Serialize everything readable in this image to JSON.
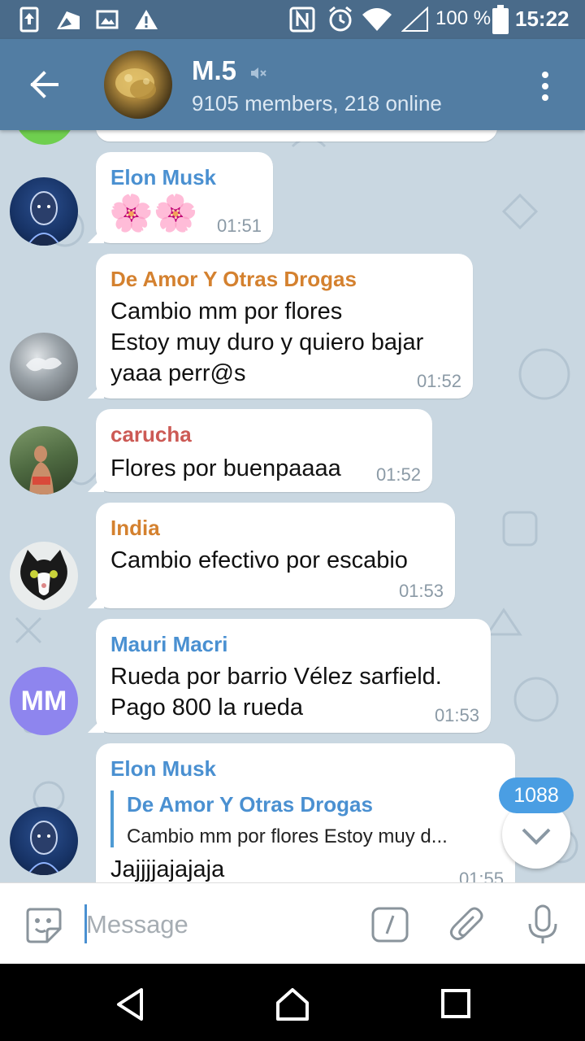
{
  "status_bar": {
    "battery": "100 %",
    "time": "15:22"
  },
  "header": {
    "title": "M.5",
    "subtitle": "9105 members, 218 online"
  },
  "messages": [
    {
      "sender": "Elon Musk",
      "sender_color": "#4a90d1",
      "text": "🌸🌸",
      "time": "01:51"
    },
    {
      "sender": "De Amor Y Otras Drogas",
      "sender_color": "#d4812f",
      "text": "Cambio mm por flores\nEstoy muy duro y quiero bajar\nyaaa perr@s",
      "time": "01:52"
    },
    {
      "sender": "carucha",
      "sender_color": "#cc5a55",
      "text": "Flores por buenpaaaa",
      "time": "01:52"
    },
    {
      "sender": "India",
      "sender_color": "#d4812f",
      "text": "Cambio efectivo por escabio",
      "time": "01:53"
    },
    {
      "sender": "Mauri Macri",
      "sender_color": "#4a90d1",
      "text": "Rueda por barrio Vélez sarfield.\nPago 800 la rueda",
      "time": "01:53",
      "avatar_initials": "MM"
    },
    {
      "sender": "Elon Musk",
      "sender_color": "#4a90d1",
      "reply_to": "De Amor Y Otras Drogas",
      "reply_text": "Cambio mm por flores Estoy muy d...",
      "text": "Jajjjjajajaja",
      "time": "01:55"
    }
  ],
  "unread_count": "1088",
  "input": {
    "placeholder": "Message"
  },
  "colors": {
    "header": "#527da3",
    "status_bar": "#4a6b8a",
    "chat_background": "#c9d7e1",
    "accent": "#4a9ee3"
  }
}
